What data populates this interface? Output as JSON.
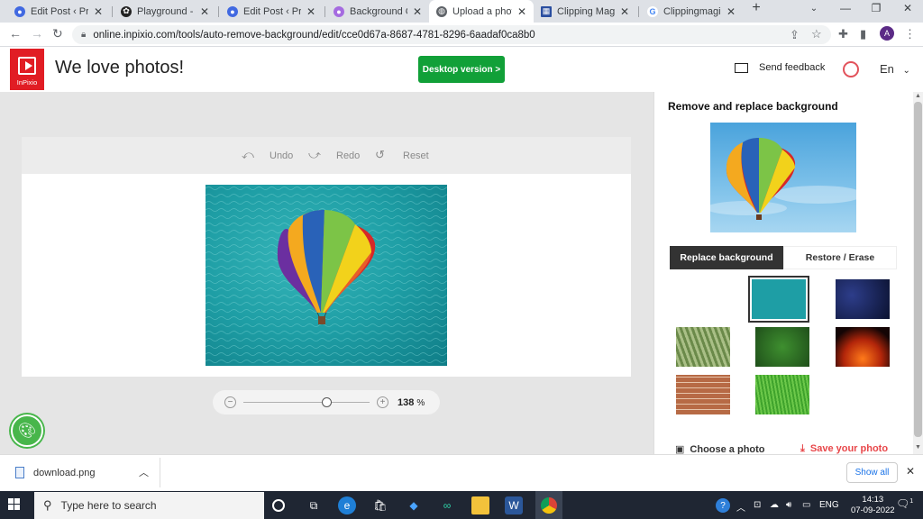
{
  "browser": {
    "tabs": [
      {
        "title": "Edit Post ‹ Predis",
        "active": false
      },
      {
        "title": "Playground - Ope",
        "active": false
      },
      {
        "title": "Edit Post ‹ Predis",
        "active": false
      },
      {
        "title": "Background Cha",
        "active": false
      },
      {
        "title": "Upload a photo",
        "active": true
      },
      {
        "title": "Clipping Magic",
        "active": false
      },
      {
        "title": "Clippingmagic lo",
        "active": false
      }
    ],
    "url": "online.inpixio.com/tools/auto-remove-background/edit/cce0d67a-8687-4781-8296-6aadaf0ca8b0",
    "profile_initial": "A"
  },
  "site": {
    "logo_text": "InPixio",
    "title": "We love photos!",
    "desktop_button": "Desktop version >",
    "send_feedback": "Send feedback",
    "language": "En"
  },
  "editor": {
    "undo": "Undo",
    "redo": "Redo",
    "reset": "Reset",
    "zoom_value": "138",
    "zoom_unit": "%",
    "zoom_fraction": 0.66
  },
  "sidebar": {
    "title": "Remove and replace background",
    "tab_replace": "Replace background",
    "tab_restore": "Restore / Erase",
    "backgrounds": [
      {
        "kind": "white",
        "selected": false
      },
      {
        "kind": "original-sea",
        "selected": true
      },
      {
        "kind": "night-sky",
        "selected": false
      },
      {
        "kind": "palm-leaves",
        "selected": false
      },
      {
        "kind": "green-leaves",
        "selected": false
      },
      {
        "kind": "fire",
        "selected": false
      },
      {
        "kind": "brick-wall",
        "selected": false
      },
      {
        "kind": "grass",
        "selected": false
      }
    ],
    "choose_photo": "Choose a photo",
    "save_photo": "Save your photo"
  },
  "downloads": {
    "file": "download.png",
    "show_all": "Show all"
  },
  "taskbar": {
    "search_placeholder": "Type here to search",
    "language": "ENG",
    "time": "14:13",
    "date": "07-09-2022",
    "notifications": "1"
  },
  "colors": {
    "brand_red": "#e11d24",
    "desktop_green": "#11a038",
    "save_red": "#e8474a",
    "palette_green": "#48b64b"
  }
}
